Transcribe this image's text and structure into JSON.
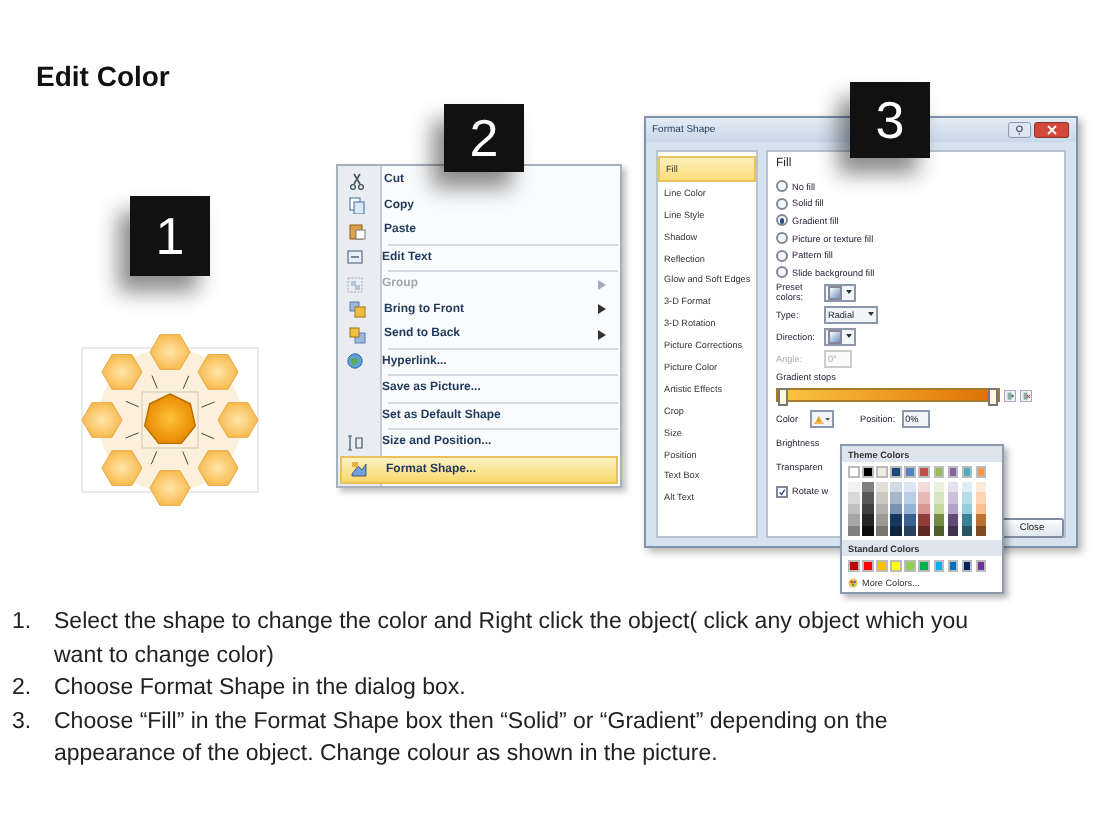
{
  "title": "Edit Color",
  "steps": [
    {
      "number": "1"
    },
    {
      "number": "2"
    },
    {
      "number": "3"
    }
  ],
  "context_menu": {
    "items": [
      {
        "label": "Cut",
        "separator_above": false,
        "disabled": false,
        "has_submenu": false,
        "selected": false
      },
      {
        "label": "Copy",
        "separator_above": false,
        "disabled": false,
        "has_submenu": false,
        "selected": false
      },
      {
        "label": "Paste",
        "separator_above": false,
        "disabled": false,
        "has_submenu": false,
        "selected": false
      },
      {
        "label": "Edit Text",
        "separator_above": true,
        "disabled": false,
        "has_submenu": false,
        "selected": false
      },
      {
        "label": "Group",
        "separator_above": true,
        "disabled": true,
        "has_submenu": true,
        "selected": false
      },
      {
        "label": "Bring to Front",
        "separator_above": false,
        "disabled": false,
        "has_submenu": true,
        "selected": false
      },
      {
        "label": "Send to Back",
        "separator_above": false,
        "disabled": false,
        "has_submenu": true,
        "selected": false
      },
      {
        "label": "Hyperlink...",
        "separator_above": true,
        "disabled": false,
        "has_submenu": false,
        "selected": false
      },
      {
        "label": "Save as Picture...",
        "separator_above": true,
        "disabled": false,
        "has_submenu": false,
        "selected": false
      },
      {
        "label": "Set as Default Shape",
        "separator_above": true,
        "disabled": false,
        "has_submenu": false,
        "selected": false
      },
      {
        "label": "Size and Position...",
        "separator_above": true,
        "disabled": false,
        "has_submenu": false,
        "selected": false
      },
      {
        "label": "Format Shape...",
        "separator_above": false,
        "disabled": false,
        "has_submenu": false,
        "selected": true
      }
    ]
  },
  "dialog": {
    "title": "Format Shape",
    "categories": [
      {
        "label": "Fill",
        "selected": true
      },
      {
        "label": "Line Color",
        "selected": false
      },
      {
        "label": "Line Style",
        "selected": false
      },
      {
        "label": "Shadow",
        "selected": false
      },
      {
        "label": "Reflection",
        "selected": false
      },
      {
        "label": "Glow and Soft Edges",
        "selected": false
      },
      {
        "label": "3-D Format",
        "selected": false
      },
      {
        "label": "3-D Rotation",
        "selected": false
      },
      {
        "label": "Picture Corrections",
        "selected": false
      },
      {
        "label": "Picture Color",
        "selected": false
      },
      {
        "label": "Artistic Effects",
        "selected": false
      },
      {
        "label": "Crop",
        "selected": false
      },
      {
        "label": "Size",
        "selected": false
      },
      {
        "label": "Position",
        "selected": false
      },
      {
        "label": "Text Box",
        "selected": false
      },
      {
        "label": "Alt Text",
        "selected": false
      }
    ],
    "heading": "Fill",
    "fill_options": [
      {
        "label": "No fill",
        "selected": false
      },
      {
        "label": "Solid fill",
        "selected": false
      },
      {
        "label": "Gradient fill",
        "selected": true
      },
      {
        "label": "Picture or texture fill",
        "selected": false
      },
      {
        "label": "Pattern fill",
        "selected": false
      },
      {
        "label": "Slide background fill",
        "selected": false
      }
    ],
    "fields": [
      {
        "kind": "swatch",
        "label": "Preset colors:",
        "disabled": false
      },
      {
        "kind": "dropdown",
        "label": "Type:",
        "value": "Radial",
        "disabled": false
      },
      {
        "kind": "swatch",
        "label": "Direction:",
        "disabled": false
      },
      {
        "kind": "spinner",
        "label": "Angle:",
        "value": "0°",
        "disabled": true
      }
    ],
    "gradient_stops_label": "Gradient stops",
    "color_label": "Color",
    "position_label": "Position:",
    "position_value": "0%",
    "brightness_label": "Brightness",
    "transparency_label": "Transparen",
    "rotate": {
      "label": "Rotate w",
      "checked": true
    },
    "close_button": "Close"
  },
  "color_popup": {
    "theme_heading": "Theme Colors",
    "theme_colors": [
      {
        "color": "#ffffff"
      },
      {
        "color": "#000000"
      },
      {
        "color": "#eeece1"
      },
      {
        "color": "#1f497d"
      },
      {
        "color": "#4f81bd"
      },
      {
        "color": "#c0504d"
      },
      {
        "color": "#9bbb59"
      },
      {
        "color": "#8064a2"
      },
      {
        "color": "#4bacc6"
      },
      {
        "color": "#f79646"
      }
    ],
    "standard_heading": "Standard Colors",
    "standard_colors": [
      {
        "color": "#c00000"
      },
      {
        "color": "#ff0000"
      },
      {
        "color": "#ffc000"
      },
      {
        "color": "#ffff00"
      },
      {
        "color": "#92d050"
      },
      {
        "color": "#00b050"
      },
      {
        "color": "#00b0f0"
      },
      {
        "color": "#0070c0"
      },
      {
        "color": "#002060"
      },
      {
        "color": "#7030a0"
      }
    ],
    "more_colors": "More Colors..."
  },
  "instructions": [
    {
      "number": "1.",
      "text": "Select the shape to change the color and Right click the object( click any object which you want to change color)"
    },
    {
      "number": "2.",
      "text": "Choose Format Shape in the dialog box."
    },
    {
      "number": "3.",
      "text": "Choose “Fill” in the Format Shape box then “Solid” or “Gradient” depending on the appearance of the object. Change colour as shown in the picture."
    }
  ]
}
